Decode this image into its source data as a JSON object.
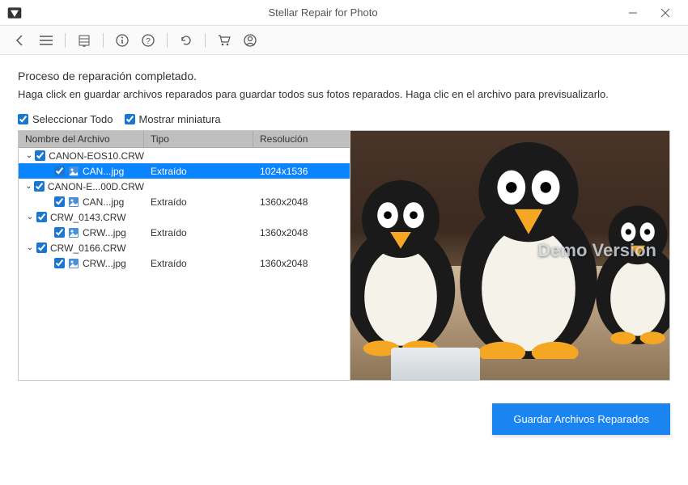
{
  "window": {
    "title": "Stellar Repair for Photo"
  },
  "toolbar": {
    "icons": {
      "back": "back-icon",
      "menu": "menu-icon",
      "list": "list-icon",
      "info": "info-icon",
      "help": "help-icon",
      "refresh": "refresh-icon",
      "cart": "cart-icon",
      "user": "user-icon"
    }
  },
  "content": {
    "heading": "Proceso de reparación completado.",
    "subheading": "Haga click en guardar archivos reparados para guardar todos sus fotos reparados. Haga clic en el archivo para previsualizarlo."
  },
  "options": {
    "select_all_label": "Seleccionar Todo",
    "select_all_checked": true,
    "show_thumb_label": "Mostrar miniatura",
    "show_thumb_checked": true
  },
  "columns": {
    "name": "Nombre del Archivo",
    "type": "Tipo",
    "resolution": "Resolución"
  },
  "tree": [
    {
      "name": "CANON-EOS10.CRW",
      "expanded": true,
      "checked": true,
      "children": [
        {
          "name": "CAN...jpg",
          "type": "Extraído",
          "resolution": "1024x1536",
          "selected": true,
          "checked": true
        }
      ]
    },
    {
      "name": "CANON-E...00D.CRW",
      "expanded": true,
      "checked": true,
      "children": [
        {
          "name": "CAN...jpg",
          "type": "Extraído",
          "resolution": "1360x2048",
          "selected": false,
          "checked": true
        }
      ]
    },
    {
      "name": "CRW_0143.CRW",
      "expanded": true,
      "checked": true,
      "children": [
        {
          "name": "CRW...jpg",
          "type": "Extraído",
          "resolution": "1360x2048",
          "selected": false,
          "checked": true
        }
      ]
    },
    {
      "name": "CRW_0166.CRW",
      "expanded": true,
      "checked": true,
      "children": [
        {
          "name": "CRW...jpg",
          "type": "Extraído",
          "resolution": "1360x2048",
          "selected": false,
          "checked": true
        }
      ]
    }
  ],
  "preview": {
    "watermark": "Demo Version"
  },
  "footer": {
    "save_button": "Guardar Archivos Reparados"
  }
}
